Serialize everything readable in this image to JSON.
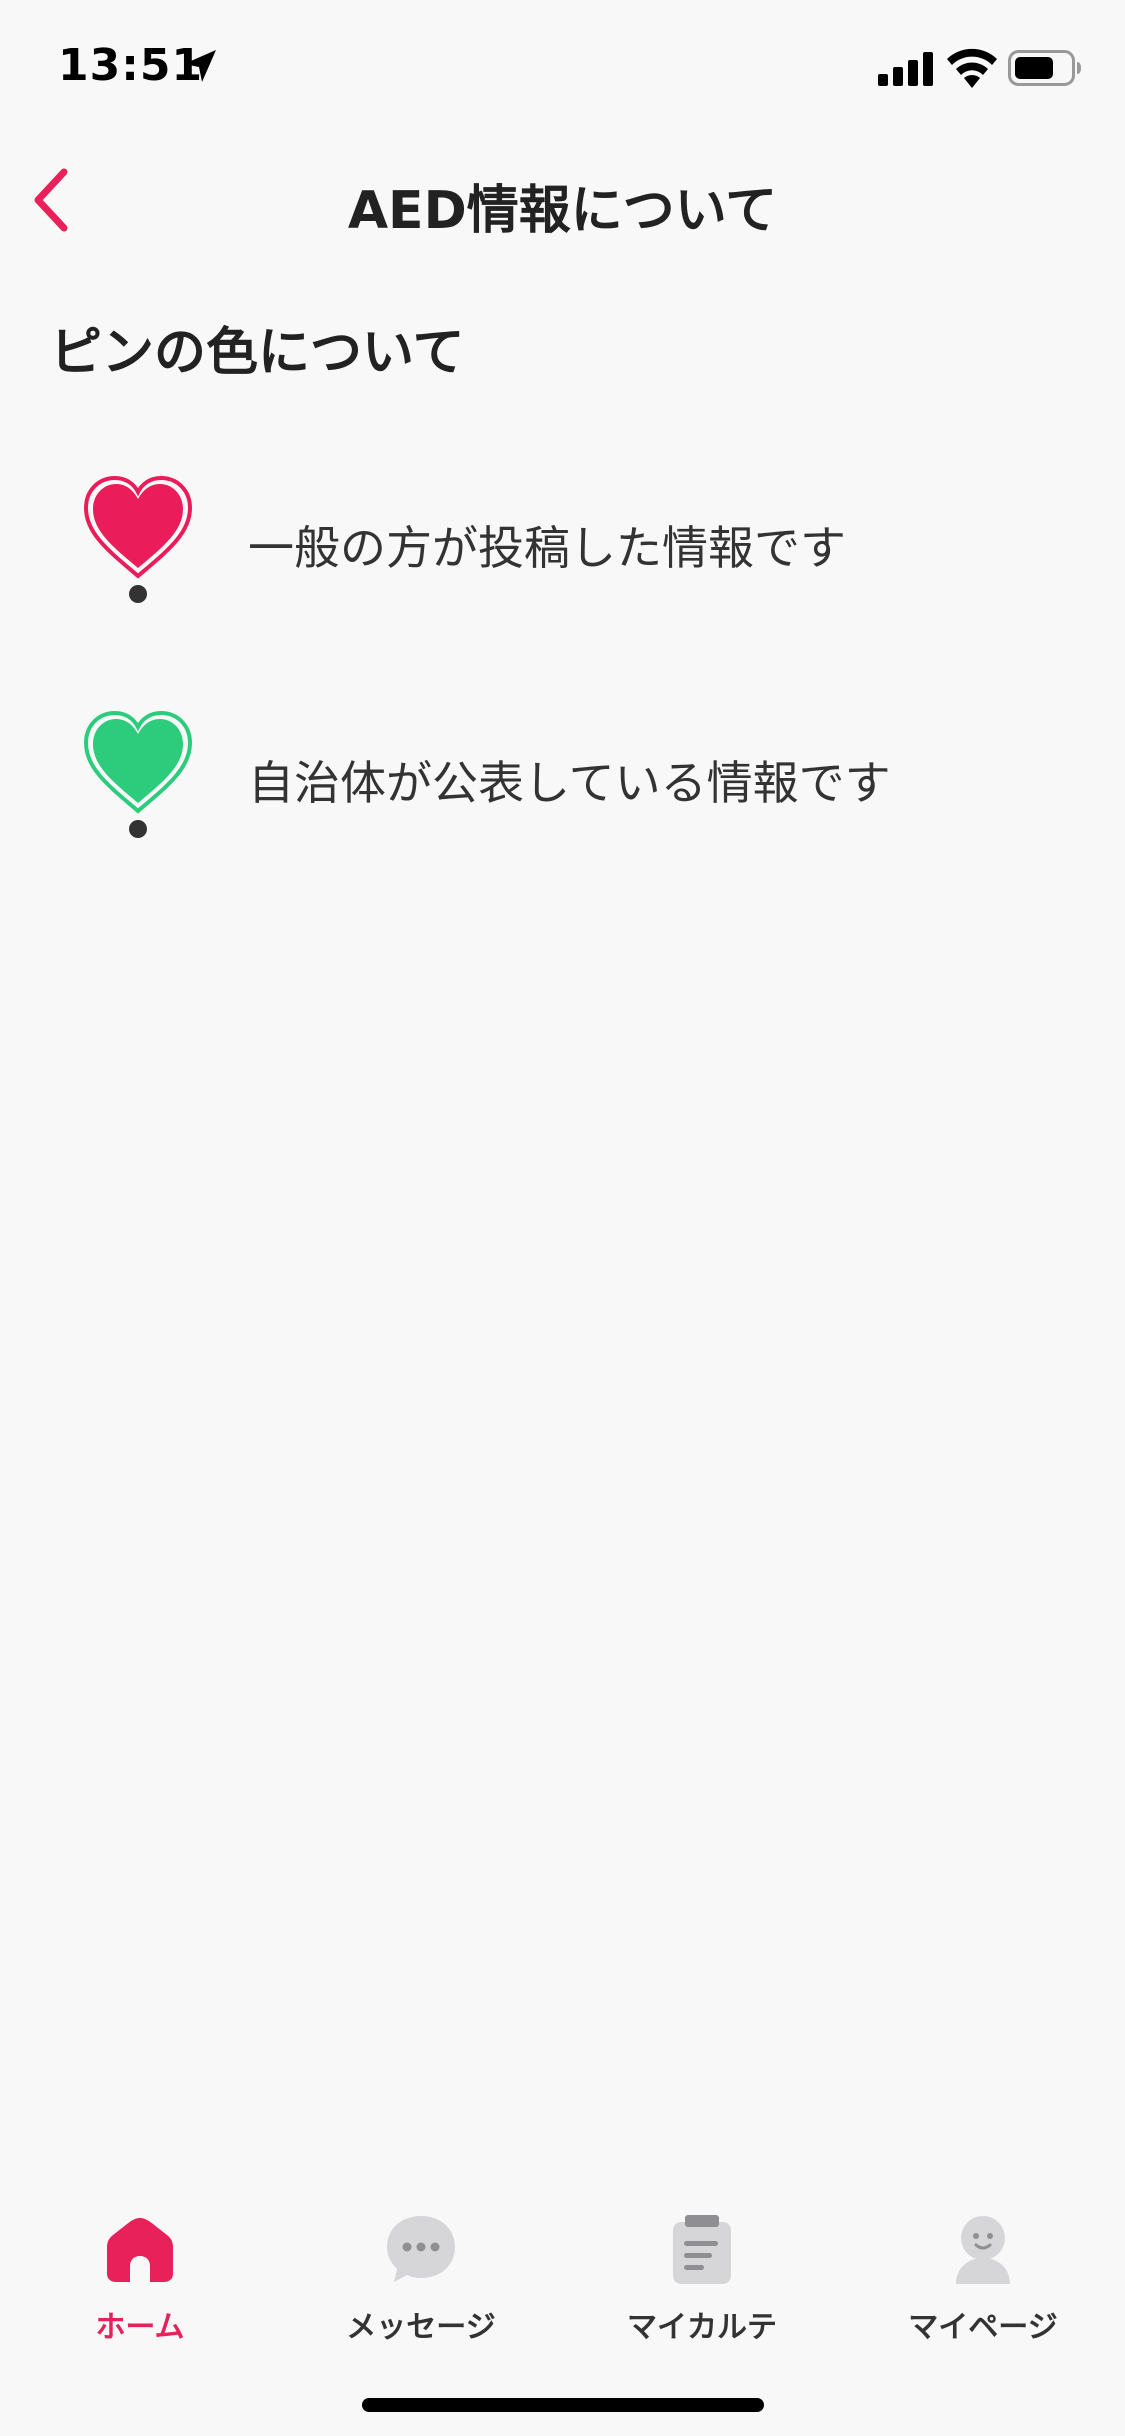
{
  "status_bar": {
    "time": "13:51",
    "icons": [
      "location-arrow-icon",
      "cellular-signal-icon",
      "wifi-icon",
      "battery-icon"
    ]
  },
  "nav": {
    "title": "AED情報について",
    "back_icon": "chevron-left-icon"
  },
  "section": {
    "title": "ピンの色について"
  },
  "legend": [
    {
      "icon": "red-heart-pin-icon",
      "color": "#ea1c5a",
      "text": "一般の方が投稿した情報です"
    },
    {
      "icon": "green-heart-pin-icon",
      "color": "#2ccc7c",
      "text": "自治体が公表している情報です"
    }
  ],
  "tabs": [
    {
      "label": "ホーム",
      "icon": "home-icon",
      "active": true
    },
    {
      "label": "メッセージ",
      "icon": "message-bubble-icon",
      "active": false
    },
    {
      "label": "マイカルテ",
      "icon": "clipboard-icon",
      "active": false
    },
    {
      "label": "マイページ",
      "icon": "person-icon",
      "active": false
    }
  ],
  "colors": {
    "accent": "#e8215a",
    "background": "#f8f8f8",
    "inactive_icon": "#d6d6d8"
  }
}
